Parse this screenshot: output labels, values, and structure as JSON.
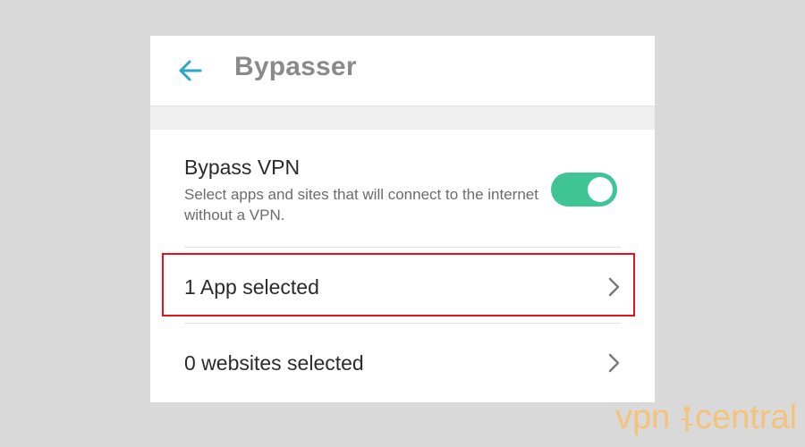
{
  "header": {
    "title": "Bypasser",
    "back_icon": "arrow-left-icon",
    "accent_color": "#2aa6c9"
  },
  "bypass_vpn": {
    "title": "Bypass VPN",
    "description": "Select apps and sites that will connect to the internet without a VPN.",
    "enabled": true,
    "toggle_color": "#3ec495"
  },
  "rows": [
    {
      "label": "1 App selected",
      "highlighted": true
    },
    {
      "label": "0 websites selected",
      "highlighted": false
    }
  ],
  "annotation": {
    "highlight_color": "#e8101d"
  },
  "watermark": {
    "part1": "vpn",
    "part2": "central",
    "color": "#f5c27a"
  }
}
